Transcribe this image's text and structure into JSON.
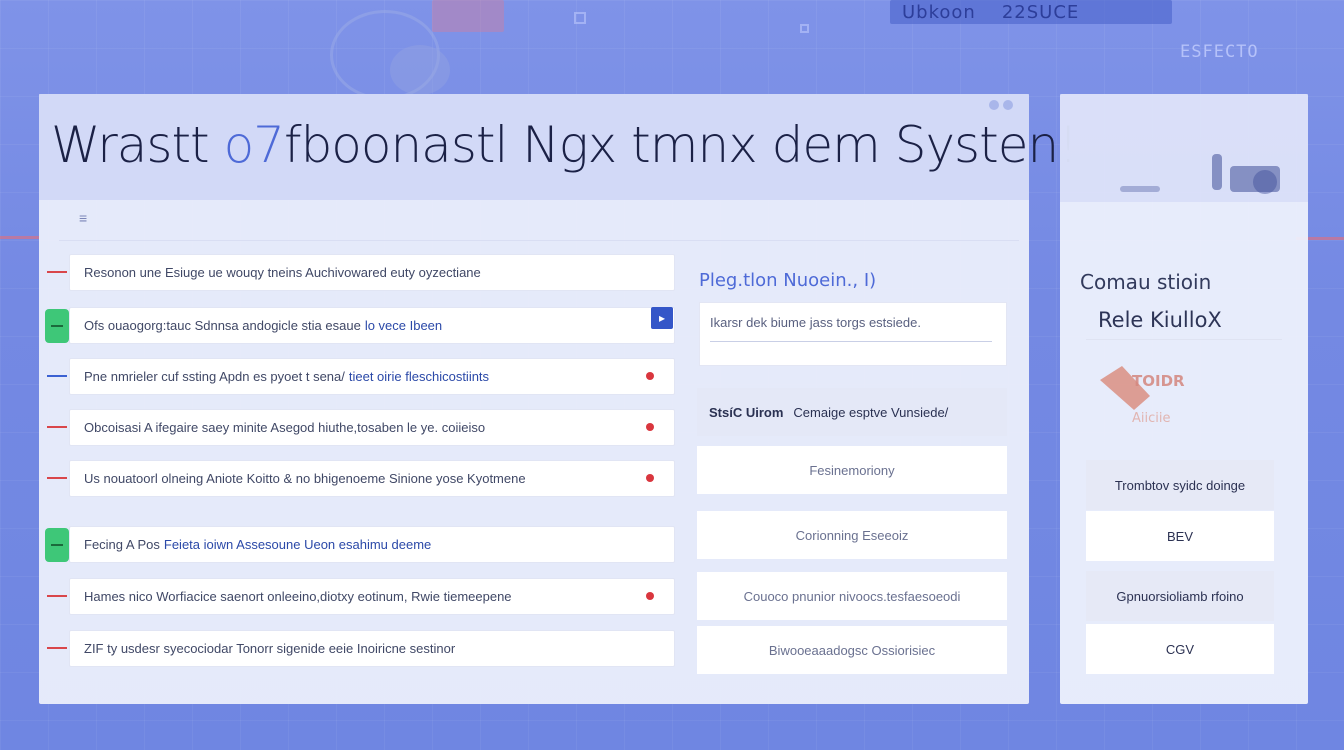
{
  "background": {
    "banner_left": "Ubkoon",
    "banner_right": "22SUCE",
    "top_right_label": "ESFECTO"
  },
  "header": {
    "title_part1": "Wrastt",
    "title_accent": "o7",
    "title_part2": "fboonastl Ngx tmnx dem  Systen!"
  },
  "list": {
    "rows": [
      {
        "text": "Resonon une Esiuge ue wouqy tneins Auchivowared euty oyzectiane",
        "highlight": "",
        "marker": "red",
        "dot": false
      },
      {
        "text": "Ofs ouaogorg:tauc Sdnnsa andogicle stia esaue",
        "highlight": "lo vece Ibeen",
        "marker": "green",
        "dot": false,
        "badge": "▸"
      },
      {
        "text": "Pne nmrieler cuf ssting Apdn es pyoet t sena/",
        "highlight": "tieet oirie fleschicostiints",
        "marker": "blue",
        "dot": true
      },
      {
        "text": "Obcoisasi A ifegaire saey minite Asegod hiuthe,tosaben le ye. coiieiso",
        "highlight": "",
        "marker": "red",
        "dot": true
      },
      {
        "text": "Us nouatoorl olneing Aniote Koitto & no bhigenoeme Sinione yose Kyotmene",
        "highlight": "",
        "marker": "red",
        "dot": true
      },
      {
        "text": "Fecing A Pos",
        "highlight": "Feieta ioiwn Assesoune Ueon esahimu deeme",
        "marker": "green",
        "dot": false
      },
      {
        "text": "Hames nico Worfiacice saenort onleeino,diotxy eotinum, Rwie tiemeepene",
        "highlight": "",
        "marker": "red",
        "dot": true
      },
      {
        "text": "ZIF ty usdesr syecociodar Tonorr sigenide eeie Inoiricne sestinor",
        "highlight": "",
        "marker": "red",
        "dot": false
      }
    ]
  },
  "middle": {
    "heading": "Pleg.tlon Nuoein., I)",
    "input_value": "Ikarsr dek  biume jass torgs estsiede.",
    "tiles": [
      {
        "label": "StsíC Uirom",
        "detail": "Cemaige esptve Vunsiede/",
        "active": true
      },
      {
        "label": "",
        "detail": "Fesinemoriony",
        "active": false
      },
      {
        "label": "",
        "detail": "Corionning Eseeoiz",
        "active": false
      },
      {
        "label": "",
        "detail": "Couoco pnunior nivoocs.tesfaesoeodi",
        "active": false
      },
      {
        "label": "",
        "detail": "Biwooeaaadogsc Ossiorisiec",
        "active": false
      }
    ]
  },
  "side": {
    "heading": "Comau stioin",
    "subheading": "Rele KiulloX",
    "logo_text_1": "TOIDR",
    "logo_text_2": "Aiiciie",
    "group1_label": "Trombtov syidc doinge",
    "group1_button": "BEV",
    "group2_label": "Gpnuorsioliamb rfoino",
    "group2_button": "CGV"
  },
  "colors": {
    "accent": "#4e6ad7",
    "marker_red": "#d9464a",
    "marker_green": "#3ec778",
    "marker_blue": "#3b61d2"
  }
}
